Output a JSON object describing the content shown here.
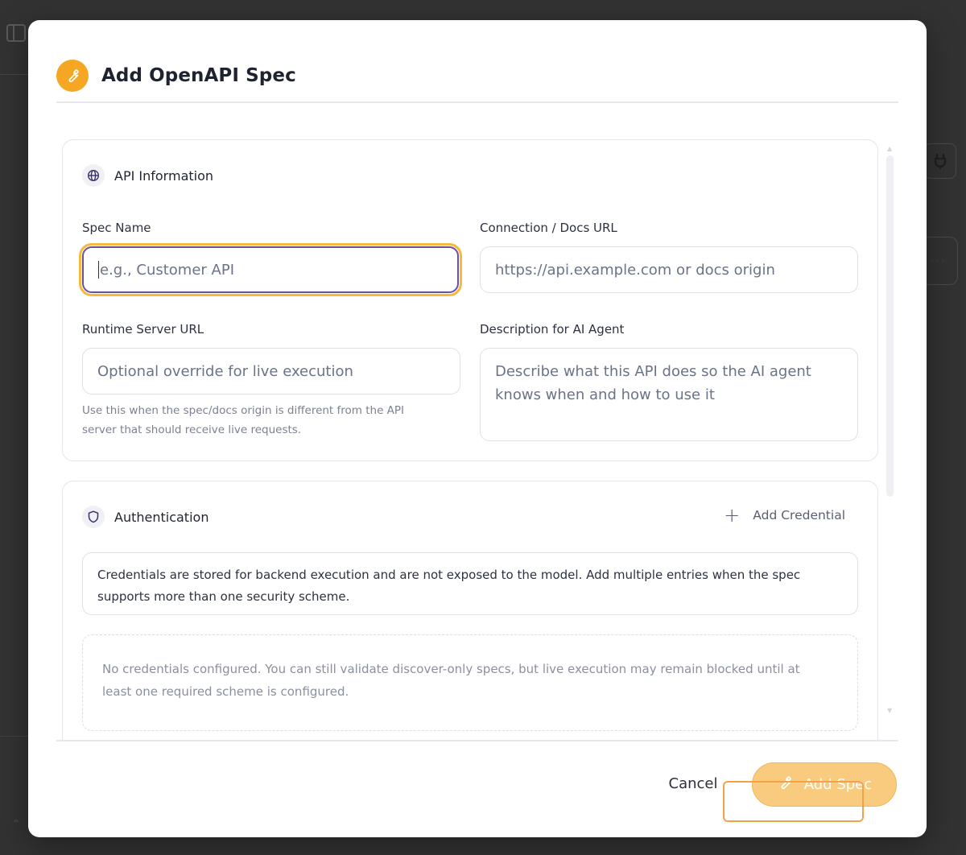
{
  "modal": {
    "title": "Add OpenAPI Spec",
    "header_icon": "wrench-icon",
    "accent_color": "#f5a623"
  },
  "api_info": {
    "section_title": "API Information",
    "section_icon": "globe-icon",
    "spec_name": {
      "label": "Spec Name",
      "value": "",
      "placeholder": "e.g., Customer API"
    },
    "connection_url": {
      "label": "Connection / Docs URL",
      "value": "",
      "placeholder": "https://api.example.com or docs origin"
    },
    "runtime_url": {
      "label": "Runtime Server URL",
      "value": "",
      "placeholder": "Optional override for live execution",
      "help_line1": "Use this when the spec/docs origin is different from the API",
      "help_line2": "server that should receive live requests."
    },
    "description": {
      "label": "Description for AI Agent",
      "value": "",
      "placeholder_line1": "Describe what this API does so the AI agent",
      "placeholder_line2": "knows when and how to use it"
    }
  },
  "authentication": {
    "section_title": "Authentication",
    "section_icon": "shield-icon",
    "add_credential_label": "Add Credential",
    "info_line1": "Credentials are stored for backend execution and are not exposed to the model. Add multiple entries when the spec",
    "info_line2": "supports more than one security scheme.",
    "empty_line1": "No credentials configured. You can still validate discover-only specs, but live execution may remain blocked until at",
    "empty_line2": "least one required scheme is configured."
  },
  "footer": {
    "cancel_label": "Cancel",
    "submit_label": "Add Spec",
    "submit_icon": "wrench-icon",
    "submit_color": "#f8cb7e"
  }
}
